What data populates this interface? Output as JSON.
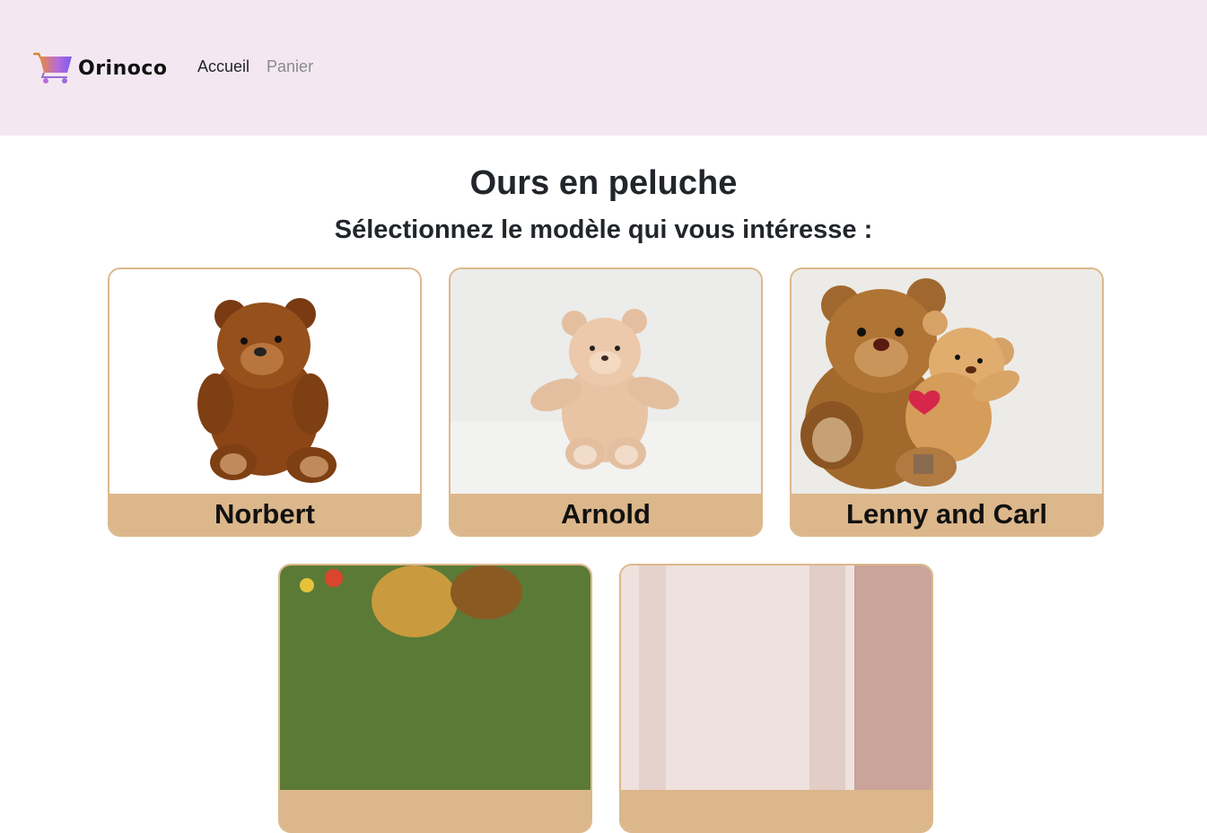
{
  "header": {
    "brand": "Orinoco",
    "nav": [
      {
        "label": "Accueil",
        "active": true
      },
      {
        "label": "Panier",
        "active": false
      }
    ],
    "background_color": "#f3e8f1"
  },
  "main": {
    "title": "Ours en peluche",
    "subtitle": "Sélectionnez le modèle qui vous intéresse :"
  },
  "products": [
    {
      "name": "Norbert"
    },
    {
      "name": "Arnold"
    },
    {
      "name": "Lenny and Carl"
    },
    {
      "name": ""
    },
    {
      "name": ""
    }
  ],
  "colors": {
    "card_accent": "#dcb78b",
    "text": "#212529",
    "muted_nav": "#8a8a8a"
  }
}
